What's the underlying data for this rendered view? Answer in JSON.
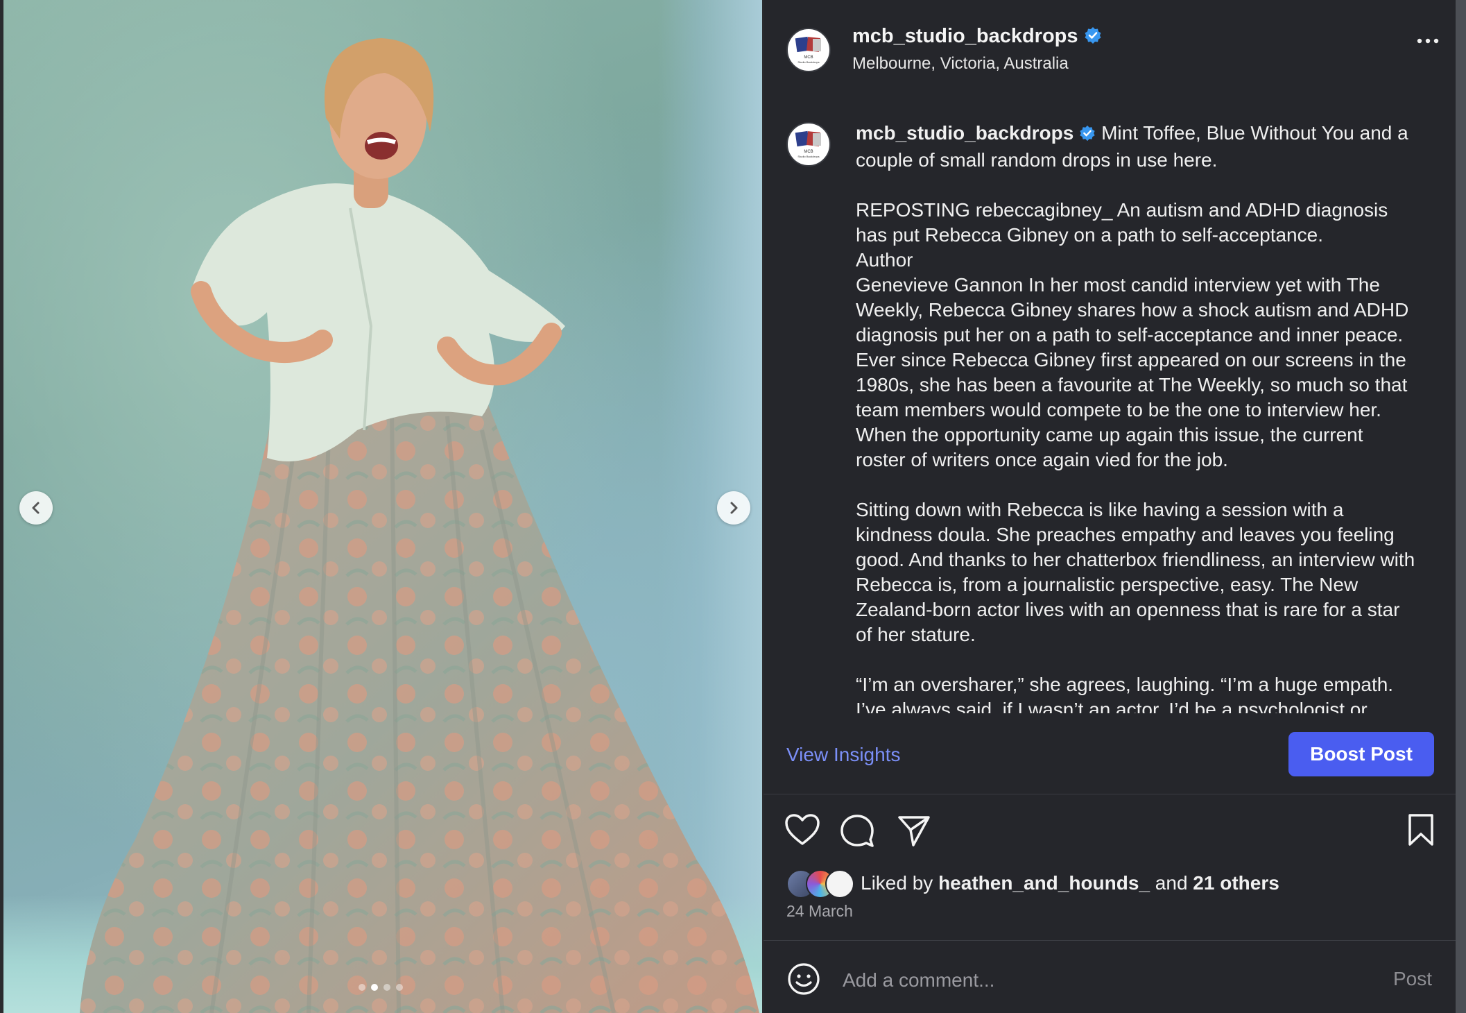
{
  "post": {
    "username": "mcb_studio_backdrops",
    "location": "Melbourne, Victoria, Australia",
    "avatar_text_top": "MCB",
    "avatar_text_bottom": "Studio Backdrops"
  },
  "caption": {
    "username": "mcb_studio_backdrops",
    "intro": " Mint Toffee, Blue Without You and a couple of small random drops in use here.",
    "paragraphs": [
      "REPOSTING rebeccagibney_ An autism and ADHD diagnosis has put Rebecca Gibney on a path to self-acceptance.\nAuthor\nGenevieve Gannon In her most candid interview yet with The Weekly, Rebecca Gibney shares how a shock autism and ADHD diagnosis put her on a path to self-acceptance and inner peace. Ever since Rebecca Gibney first appeared on our screens in the 1980s, she has been a favourite at The Weekly, so much so that team members would compete to be the one to interview her. When the opportunity came up again this issue, the current roster of writers once again vied for the job.",
      "Sitting down with Rebecca is like having a session with a kindness doula. She preaches empathy and leaves you feeling good. And thanks to her chatterbox friendliness, an interview with Rebecca is, from a journalistic perspective, easy. The New Zealand-born actor lives with an openness that is rare for a star of her stature.",
      "“I’m an oversharer,” she agrees, laughing. “I’m a huge empath. I’ve always said, if I wasn’t an actor, I’d be a psychologist or"
    ]
  },
  "actions": {
    "view_insights": "View Insights",
    "boost_post": "Boost Post"
  },
  "likes": {
    "prefix": "Liked by ",
    "user": "heathen_and_hounds_",
    "middle": " and ",
    "others": "21 others"
  },
  "date": "24 March",
  "comment": {
    "placeholder": "Add a comment...",
    "post_label": "Post"
  },
  "carousel": {
    "slide_count": 4,
    "active_index": 1
  },
  "colors": {
    "panel_bg": "#25262b",
    "accent_link": "#7b8ff7",
    "boost_button": "#4a5df0",
    "verified_badge": "#3897f0"
  },
  "icons": [
    "chevron-left-icon",
    "chevron-right-icon",
    "verified-badge-icon",
    "more-options-icon",
    "heart-icon",
    "comment-icon",
    "share-icon",
    "bookmark-icon",
    "emoji-icon"
  ]
}
